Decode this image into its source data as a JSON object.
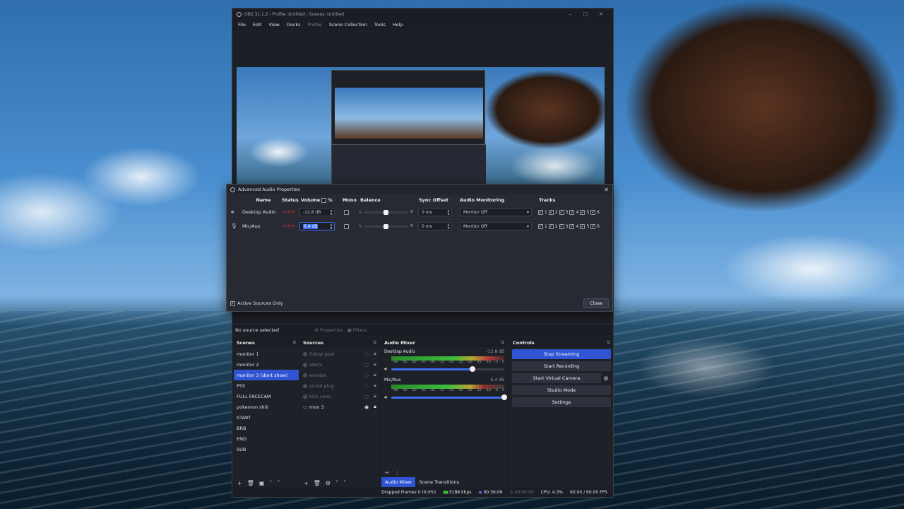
{
  "window": {
    "title": "OBS 31.1.2 - Profile: Untitled - Scenes: Untitled",
    "controls": [
      "–",
      "▢",
      "✕"
    ]
  },
  "menu": [
    "File",
    "Edit",
    "View",
    "Docks",
    "Profile",
    "Scene Collection",
    "Tools",
    "Help"
  ],
  "source_bar": {
    "selected": "No source selected",
    "properties": "Properties",
    "filters": "Filters"
  },
  "scenes": {
    "title": "Scenes",
    "items": [
      "monitor 1",
      "monitor 2",
      "monitor 3 (dont show)",
      "PS5",
      "FULL FACECAM",
      "pokemon shiii",
      "START",
      "BRB",
      "END",
      "SUB"
    ],
    "selected_index": 2
  },
  "sources": {
    "title": "Sources",
    "items": [
      {
        "name": "follow goal",
        "icon": "browser-icon",
        "visible": false
      },
      {
        "name": "alerts",
        "icon": "browser-icon",
        "visible": false
      },
      {
        "name": "emotes",
        "icon": "browser-icon",
        "visible": false
      },
      {
        "name": "social plug",
        "icon": "browser-icon",
        "visible": false
      },
      {
        "name": "kick.com/",
        "icon": "browser-icon",
        "visible": false
      },
      {
        "name": "mon 3",
        "icon": "monitor-icon",
        "visible": true
      }
    ]
  },
  "mixer": {
    "title": "Audio Mixer",
    "ticks": [
      "-60",
      "-55",
      "-50",
      "-45",
      "-40",
      "-35",
      "-30",
      "-25",
      "-20",
      "-15",
      "-10",
      "-5",
      "0"
    ],
    "channels": [
      {
        "name": "Desktop Audio",
        "db": "-12.8 dB",
        "volume_level": 0.72
      },
      {
        "name": "Mic/Aux",
        "db": "6.4 dB",
        "volume_level": 1.0
      }
    ],
    "tabs": [
      "Audio Mixer",
      "Scene Transitions"
    ]
  },
  "controls": {
    "title": "Controls",
    "stop_streaming": "Stop Streaming",
    "start_recording": "Start Recording",
    "start_virtual_camera": "Start Virtual Camera",
    "studio_mode": "Studio Mode",
    "settings": "Settings"
  },
  "status": {
    "dropped": "Dropped Frames 0 (0.0%)",
    "kbps": "5188 kbps",
    "stream_time": "00:36:06",
    "rec_time": "00:00:00",
    "cpu": "CPU: 4.3%",
    "fps": "60.00 / 60.00 FPS"
  },
  "dialog": {
    "title": "Advanced Audio Properties",
    "columns": {
      "name": "Name",
      "status": "Status",
      "volume": "Volume",
      "percent": "%",
      "mono": "Mono",
      "balance": "Balance",
      "sync": "Sync Offset",
      "monitoring": "Audio Monitoring",
      "tracks": "Tracks"
    },
    "rows": [
      {
        "name": "Desktop Audio",
        "status": "Active",
        "volume": "-12.8 dB",
        "sync": "0 ms",
        "monitoring": "Monitor Off",
        "balance": 0.5
      },
      {
        "name": "Mic/Aux",
        "status": "Active",
        "volume": "6.4 dB",
        "sync": "0 ms",
        "monitoring": "Monitor Off",
        "balance": 0.5
      }
    ],
    "balance_left": "L",
    "balance_right": "R",
    "track_labels": [
      "1",
      "2",
      "3",
      "4",
      "5",
      "6"
    ],
    "active_only": "Active Sources Only",
    "close": "Close"
  },
  "colors": {
    "accent": "#2f55d4",
    "status_active": "#c53030",
    "meter_green": "#3bbf3b"
  }
}
